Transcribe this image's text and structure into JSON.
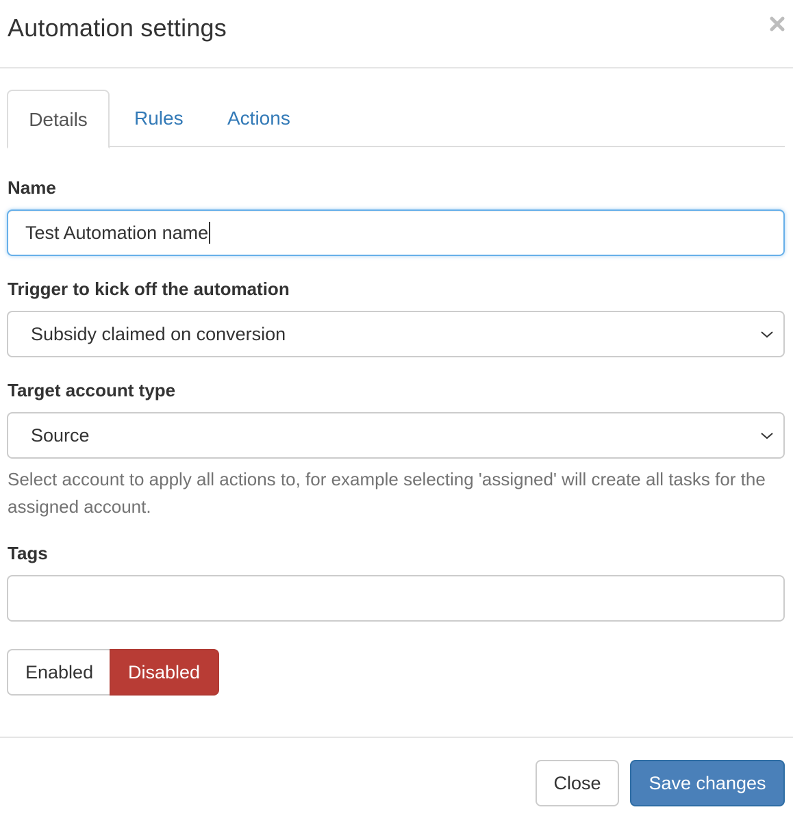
{
  "modal": {
    "title": "Automation settings",
    "close_icon": "close-icon"
  },
  "tabs": [
    {
      "label": "Details",
      "active": true
    },
    {
      "label": "Rules",
      "active": false
    },
    {
      "label": "Actions",
      "active": false
    }
  ],
  "form": {
    "name": {
      "label": "Name",
      "value": "Test Automation name"
    },
    "trigger": {
      "label": "Trigger to kick off the automation",
      "value": "Subsidy claimed on conversion"
    },
    "target": {
      "label": "Target account type",
      "value": "Source",
      "help": "Select account to apply all actions to, for example selecting 'assigned' will create all tasks for the assigned account."
    },
    "tags": {
      "label": "Tags",
      "value": ""
    },
    "status": {
      "enabled_label": "Enabled",
      "disabled_label": "Disabled",
      "selected": "Disabled"
    }
  },
  "footer": {
    "close_label": "Close",
    "save_label": "Save changes"
  },
  "colors": {
    "link": "#337ab7",
    "danger": "#b83c35",
    "primary": "#4a80b9",
    "focus": "#66afe9"
  }
}
